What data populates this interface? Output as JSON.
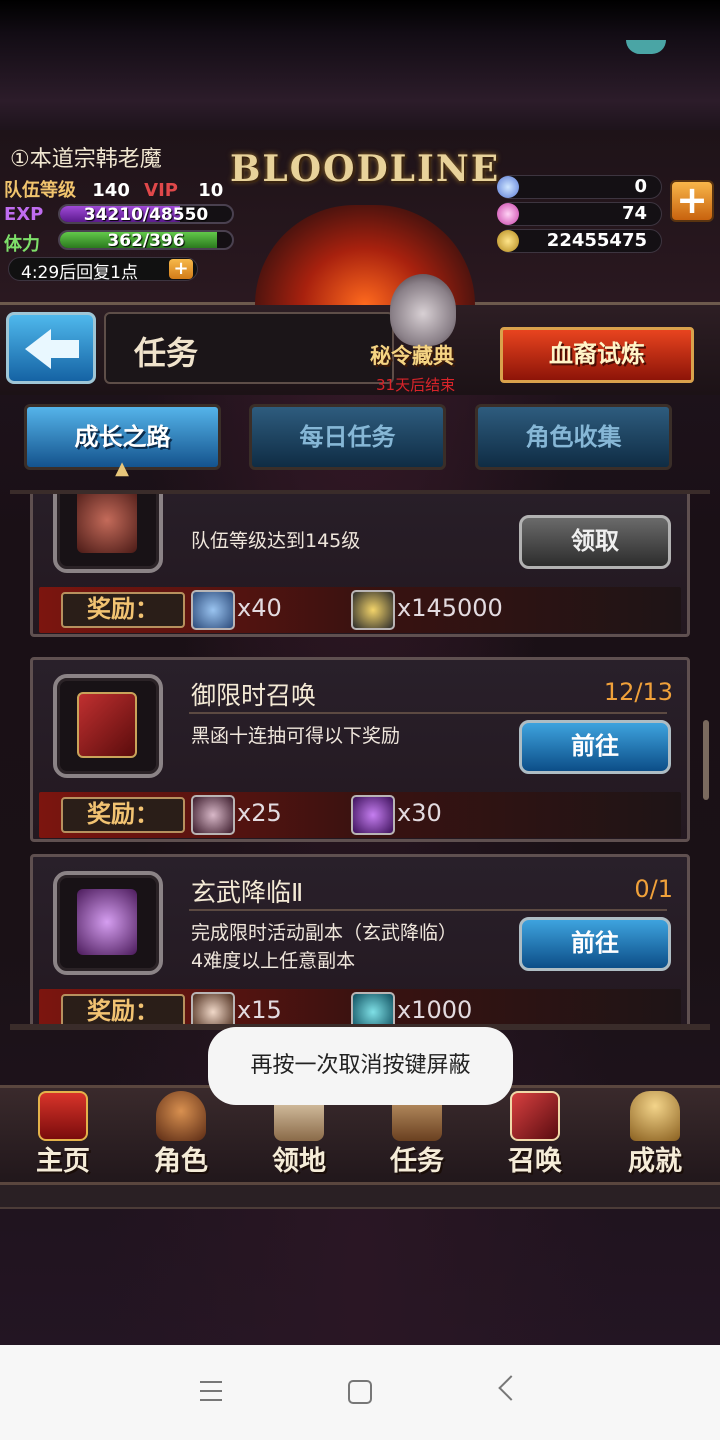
{
  "player": {
    "name": "①本道宗韩老魔",
    "team_level_label": "队伍等级",
    "team_level": "140",
    "vip_label": "VIP",
    "vip": "10",
    "exp_label": "EXP",
    "exp": "34210/48550",
    "exp_fraction": 0.7,
    "stamina_label": "体力",
    "stamina": "362/396",
    "stamina_fraction": 0.91,
    "recover_text": "4:29后回复1点"
  },
  "logo": {
    "text": "BLOODLINE"
  },
  "currency": {
    "crystal": "0",
    "gem": "74",
    "gold": "22455475"
  },
  "titlebar": {
    "title": "任务",
    "event_name": "秘令藏典",
    "event_countdown": "31天后结束",
    "trial_button": "血裔试炼"
  },
  "tabs": [
    {
      "label": "成长之路",
      "active": true
    },
    {
      "label": "每日任务",
      "active": false
    },
    {
      "label": "角色收集",
      "active": false
    }
  ],
  "quests": [
    {
      "title": "",
      "progress": "",
      "desc": "队伍等级达到145级",
      "button": "领取",
      "reward_label": "奖励：",
      "rewards": [
        {
          "icon": "character-card-icon",
          "qty": "x40"
        },
        {
          "icon": "gold-coin-icon",
          "qty": "x145000"
        }
      ]
    },
    {
      "title": "御限时召唤",
      "progress": "12/13",
      "desc": "黑函十连抽可得以下奖励",
      "button": "前往",
      "reward_label": "奖励：",
      "rewards": [
        {
          "icon": "character-card-icon",
          "qty": "x25"
        },
        {
          "icon": "purple-orb-icon",
          "qty": "x30"
        }
      ]
    },
    {
      "title": "玄武降临Ⅱ",
      "progress": "0/1",
      "desc": "完成限时活动副本（玄武降临）",
      "desc2": "4难度以上任意副本",
      "button": "前往",
      "reward_label": "奖励：",
      "rewards": [
        {
          "icon": "character-card-icon",
          "qty": "x15"
        },
        {
          "icon": "teal-orb-icon",
          "qty": "x1000"
        }
      ]
    }
  ],
  "toast": "再按一次取消按键屏蔽",
  "nav": [
    {
      "label": "主页",
      "icon": "home-banner-icon"
    },
    {
      "label": "角色",
      "icon": "character-icon"
    },
    {
      "label": "领地",
      "icon": "castle-icon"
    },
    {
      "label": "任务",
      "icon": "quest-book-icon"
    },
    {
      "label": "召唤",
      "icon": "summon-cards-icon"
    },
    {
      "label": "成就",
      "icon": "trophy-icon"
    }
  ],
  "colors": {
    "accent_blue": "#2f8fd2",
    "progress_orange": "#f0a13a",
    "reward_gold": "#f2c372"
  }
}
